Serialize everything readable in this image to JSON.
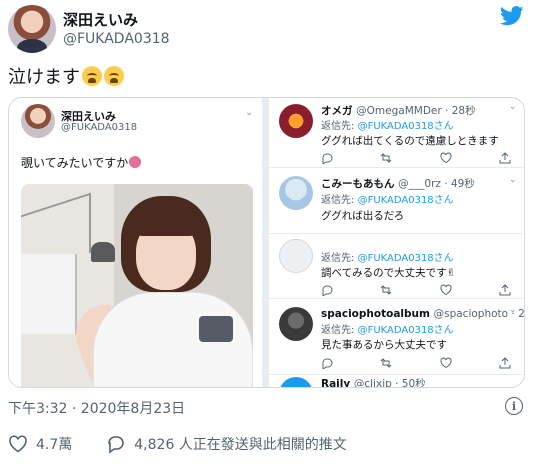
{
  "author": {
    "name": "深田えいみ",
    "handle": "@FUKADA0318"
  },
  "tweet": {
    "text": "泣けます",
    "timestamp": "下午3:32 · 2020年8月23日",
    "likes": "4.7萬",
    "reply_summary": "4,826 人正在發送與此相關的推文"
  },
  "quoted": {
    "name": "深田えいみ",
    "handle": "@FUKADA0318",
    "text": "覗いてみたいですか"
  },
  "replies": [
    {
      "name": "オメガ",
      "meta": "@OmegaMMDer · 28秒",
      "to_prefix": "返信先: ",
      "to": "@FUKADA0318さん",
      "body": "ググれば出てくるので遠慮しときます"
    },
    {
      "name": "こみーもあもん",
      "meta": "@___0rz · 49秒",
      "to_prefix": "返信先: ",
      "to": "@FUKADA0318さん",
      "body": "ググれば出るだろ"
    },
    {
      "name": "",
      "meta": "",
      "to_prefix": "返信先: ",
      "to": "@FUKADA0318さん",
      "body": "調べてみるので大丈夫です✌"
    },
    {
      "name": "spaciophotoalbum",
      "meta": "@spaciophoto · 28秒",
      "to_prefix": "返信先: ",
      "to": "@FUKADA0318さん",
      "body": "見た事あるから大丈夫です"
    },
    {
      "name": "Raily",
      "meta": "@clixjp · 50秒",
      "to_prefix": "",
      "to": "",
      "body": ""
    }
  ],
  "colors": {
    "accent": "#1d9bf0",
    "muted": "#536471",
    "border": "#cfd9de"
  },
  "icons": [
    "twitter-bird-icon",
    "crying-face-emoji",
    "info-icon",
    "heart-icon",
    "reply-icon",
    "retweet-icon",
    "share-icon",
    "chevron-down-icon"
  ]
}
